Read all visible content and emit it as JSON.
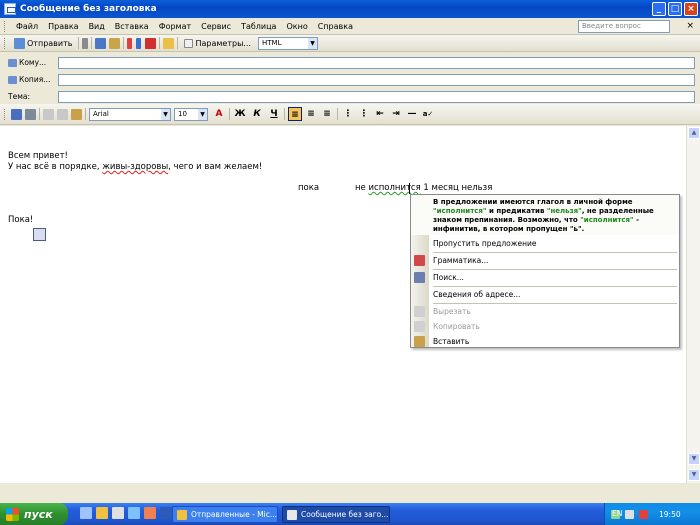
{
  "window": {
    "title": "Сообщение без заголовка",
    "controls": [
      "_",
      "□",
      "×"
    ]
  },
  "menu": {
    "items": [
      "Файл",
      "Правка",
      "Вид",
      "Вставка",
      "Формат",
      "Сервис",
      "Таблица",
      "Окно",
      "Справка"
    ],
    "help_placeholder": "Введите вопрос",
    "close": "×"
  },
  "toolbar": {
    "send_label": "Отправить",
    "options_label": "Параметры...",
    "format_value": "HTML"
  },
  "address": {
    "to_label": "Кому...",
    "cc_label": "Копия...",
    "subject_label": "Тема:",
    "to_value": "",
    "cc_value": "",
    "subject_value": ""
  },
  "format_bar": {
    "font": "Arial",
    "size": "10",
    "bold": "Ж",
    "italic": "К",
    "underline": "Ч"
  },
  "body": {
    "greeting": "Всем привет!",
    "line2_start": "У нас всё в порядке, ",
    "line2_error": "живы-здоровы",
    "line2_end": ", чего и вам желаем!",
    "word_poka": "пока",
    "word_ne": "не",
    "word_ispolnitsya": "исполнится",
    "line3_rest": " 1 месяц нельзя",
    "bye": "Пока!"
  },
  "context_menu": {
    "head_1": "В предложении имеются глагол в личной форме",
    "head_q1": "\"исполнится\"",
    "head_mid": " и предикатив ",
    "head_q2": "\"нельзя\"",
    "head_2": ", не разделенные",
    "head_3": "знаком препинания. Возможно, что ",
    "head_q3": "\"исполнится\"",
    "head_4": " -",
    "head_5": "инфинитив, в котором пропущен \"ь\".",
    "items": [
      {
        "label": "Пропустить предложение",
        "disabled": false
      },
      {
        "label": "Грамматика...",
        "disabled": false
      },
      {
        "label": "Поиск...",
        "disabled": false
      },
      {
        "label": "Сведения об адресе...",
        "disabled": false
      },
      {
        "label": "Вырезать",
        "disabled": true
      },
      {
        "label": "Копировать",
        "disabled": true
      },
      {
        "label": "Вставить",
        "disabled": false
      }
    ]
  },
  "taskbar": {
    "start": "пуск",
    "task1": "Отправленные - Mic...",
    "task2": "Сообщение без заго...",
    "lang": "EN",
    "time": "19:50"
  },
  "colors": {
    "accent": "#0a5fd8",
    "start_green": "#2f8f2f",
    "grammar_green": "#1a8a1a",
    "spell_red": "#e02020"
  }
}
